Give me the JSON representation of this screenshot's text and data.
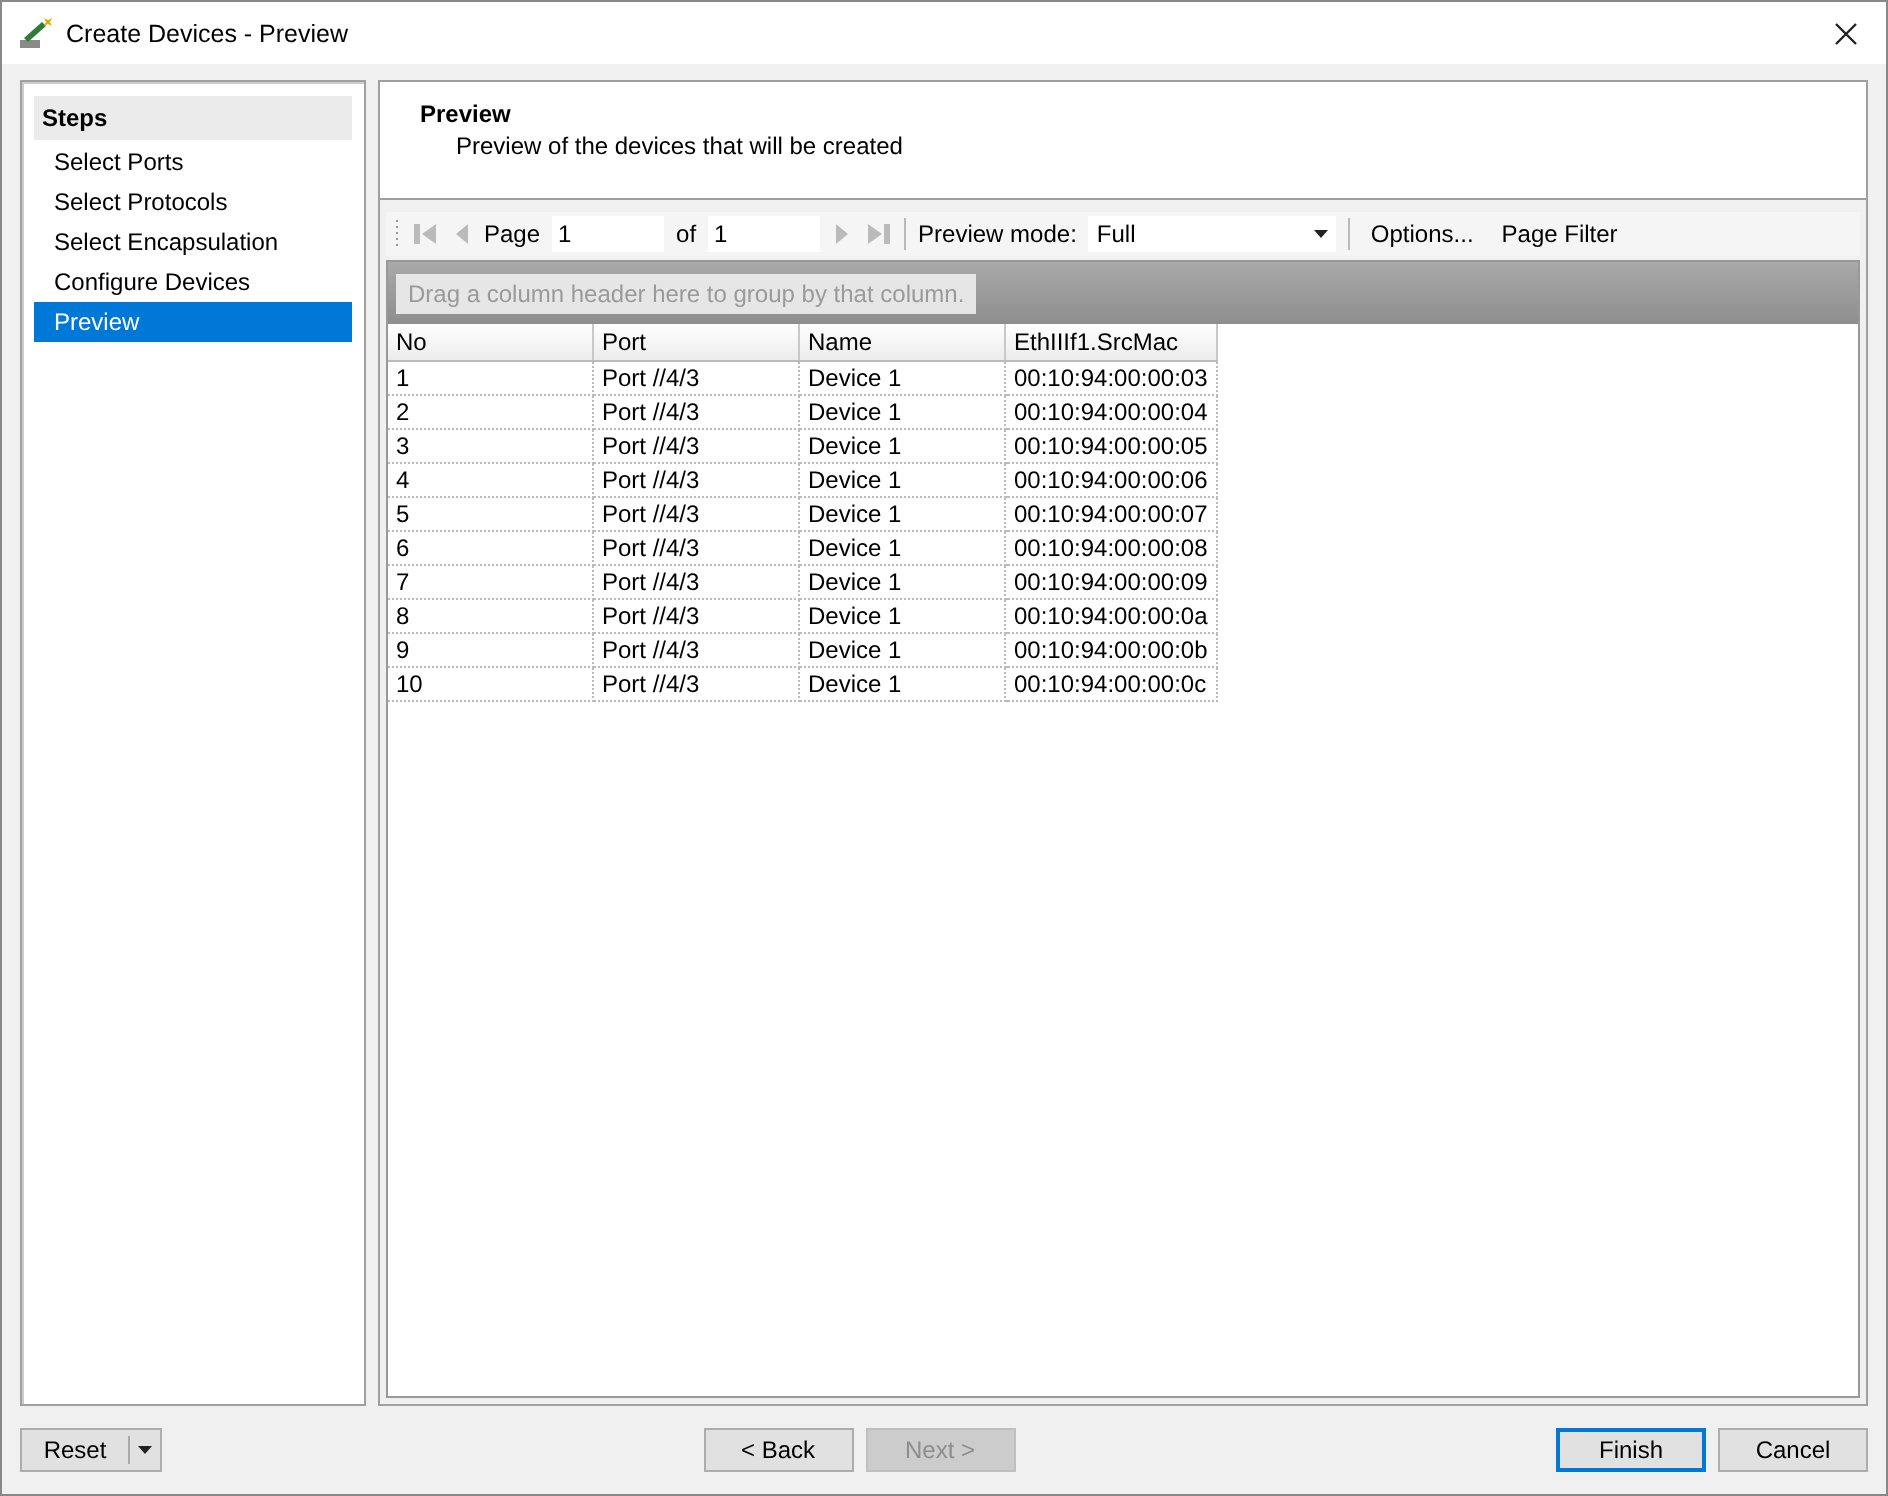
{
  "window": {
    "title": "Create Devices - Preview"
  },
  "steps": {
    "title": "Steps",
    "items": [
      {
        "label": "Select Ports",
        "selected": false
      },
      {
        "label": "Select Protocols",
        "selected": false
      },
      {
        "label": "Select Encapsulation",
        "selected": false
      },
      {
        "label": "Configure Devices",
        "selected": false
      },
      {
        "label": "Preview",
        "selected": true
      }
    ]
  },
  "header": {
    "title": "Preview",
    "subtitle": "Preview of the devices that will be created"
  },
  "pager": {
    "page_label": "Page",
    "page": "1",
    "of_label": "of",
    "total": "1"
  },
  "preview_mode": {
    "label": "Preview mode:",
    "value": "Full"
  },
  "toolbar_links": [
    "Options...",
    "Page Filter"
  ],
  "group_hint": "Drag a column header here to group by that column.",
  "table": {
    "columns": [
      "No",
      "Port",
      "Name",
      "EthIIIf1.SrcMac"
    ],
    "rows": [
      [
        "1",
        "Port //4/3",
        "Device 1",
        "00:10:94:00:00:03"
      ],
      [
        "2",
        "Port //4/3",
        "Device 1",
        "00:10:94:00:00:04"
      ],
      [
        "3",
        "Port //4/3",
        "Device 1",
        "00:10:94:00:00:05"
      ],
      [
        "4",
        "Port //4/3",
        "Device 1",
        "00:10:94:00:00:06"
      ],
      [
        "5",
        "Port //4/3",
        "Device 1",
        "00:10:94:00:00:07"
      ],
      [
        "6",
        "Port //4/3",
        "Device 1",
        "00:10:94:00:00:08"
      ],
      [
        "7",
        "Port //4/3",
        "Device 1",
        "00:10:94:00:00:09"
      ],
      [
        "8",
        "Port //4/3",
        "Device 1",
        "00:10:94:00:00:0a"
      ],
      [
        "9",
        "Port //4/3",
        "Device 1",
        "00:10:94:00:00:0b"
      ],
      [
        "10",
        "Port //4/3",
        "Device 1",
        "00:10:94:00:00:0c"
      ]
    ]
  },
  "buttons": [
    {
      "label": "Reset",
      "kind": "split",
      "disabled": false,
      "default": false
    },
    {
      "label": "< Back",
      "kind": "nav",
      "disabled": false,
      "default": false
    },
    {
      "label": "Next >",
      "kind": "nav",
      "disabled": true,
      "default": false
    },
    {
      "label": "Finish",
      "kind": "action",
      "disabled": false,
      "default": true
    },
    {
      "label": "Cancel",
      "kind": "action",
      "disabled": false,
      "default": false
    }
  ]
}
